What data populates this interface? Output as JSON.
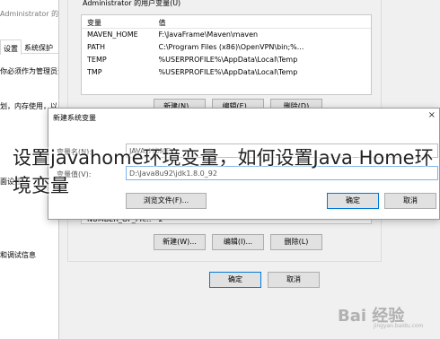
{
  "system_properties": {
    "title_fragment": "Administrator 的用户变量(U)",
    "tabs": [
      "设置",
      "系统保护",
      "远"
    ],
    "note1": "你必须作为管理员登录",
    "note2": "划，内存使用，以",
    "note3": "置文件",
    "note4": "和调试信息",
    "note5": "面设置"
  },
  "env_window": {
    "user_group_title": "Administrator 的用户变量(U)",
    "columns": [
      "变量",
      "值"
    ],
    "user_vars": [
      {
        "name": "MAVEN_HOME",
        "value": "F:\\JavaFrame\\Maven\\maven"
      },
      {
        "name": "PATH",
        "value": "C:\\Program Files (x86)\\OpenVPN\\bin;%..."
      },
      {
        "name": "TEMP",
        "value": "%USERPROFILE%\\AppData\\Local\\Temp"
      },
      {
        "name": "TMP",
        "value": "%USERPROFILE%\\AppData\\Local\\Temp"
      }
    ],
    "user_buttons": {
      "new": "新建(N)...",
      "edit": "编辑(E)...",
      "delete": "删除(D)"
    },
    "sys_partial_row": {
      "name": "NUMBER_OF_PR...",
      "value": "2"
    },
    "sys_buttons": {
      "new": "新建(W)...",
      "edit": "编辑(I)...",
      "delete": "删除(L)"
    },
    "ok": "确定",
    "cancel": "取消"
  },
  "new_var_dialog": {
    "title": "新建系统变量",
    "close": "×",
    "name_label": "变量名(N):",
    "name_value": "JAVA_HOME",
    "value_label": "变量值(V):",
    "value_value": "D:\\Java8u92\\jdk1.8.0_92",
    "browse_file": "浏览文件(F)...",
    "ok": "确定",
    "cancel": "取消"
  },
  "overlay_title": "设置javahome环境变量，如何设置Java Home环境变量",
  "watermark": {
    "text": "Bai 经验",
    "sub": "jingyan.baidu.com"
  }
}
